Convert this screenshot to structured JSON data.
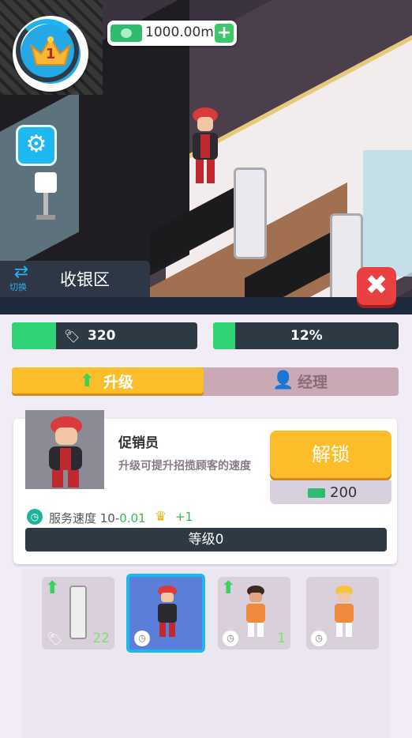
{
  "hud": {
    "player_level": "1",
    "money": "1000.00m",
    "add_money": "+",
    "settings_icon": "gear-icon"
  },
  "zone": {
    "switch_label": "切换",
    "title": "收银区",
    "close": "✖"
  },
  "stats": {
    "tags_value": "320",
    "tags_fill": 0.24,
    "percent_value": "12%",
    "percent_fill": 0.12
  },
  "tabs": {
    "upgrade": "升级",
    "manager": "经理"
  },
  "staff": {
    "name": "促销员",
    "description": "升级可提升招揽顾客的速度",
    "unlock_label": "解锁",
    "price": "200",
    "speed_label": "服务速度 10-",
    "speed_delta": "0.01",
    "crown_bonus": "+1",
    "level_label": "等级0"
  },
  "roster": [
    {
      "kind": "security-gate",
      "count": "22",
      "upgradable": true
    },
    {
      "kind": "promoter",
      "count": "",
      "upgradable": false,
      "selected": true
    },
    {
      "kind": "cashier",
      "count": "1",
      "upgradable": true
    },
    {
      "kind": "clerk",
      "count": "",
      "upgradable": false
    }
  ],
  "colors": {
    "accent_yellow": "#fbbd2a",
    "accent_blue": "#1fb7ef",
    "progress_green": "#2fd575",
    "close_red": "#e94141"
  }
}
